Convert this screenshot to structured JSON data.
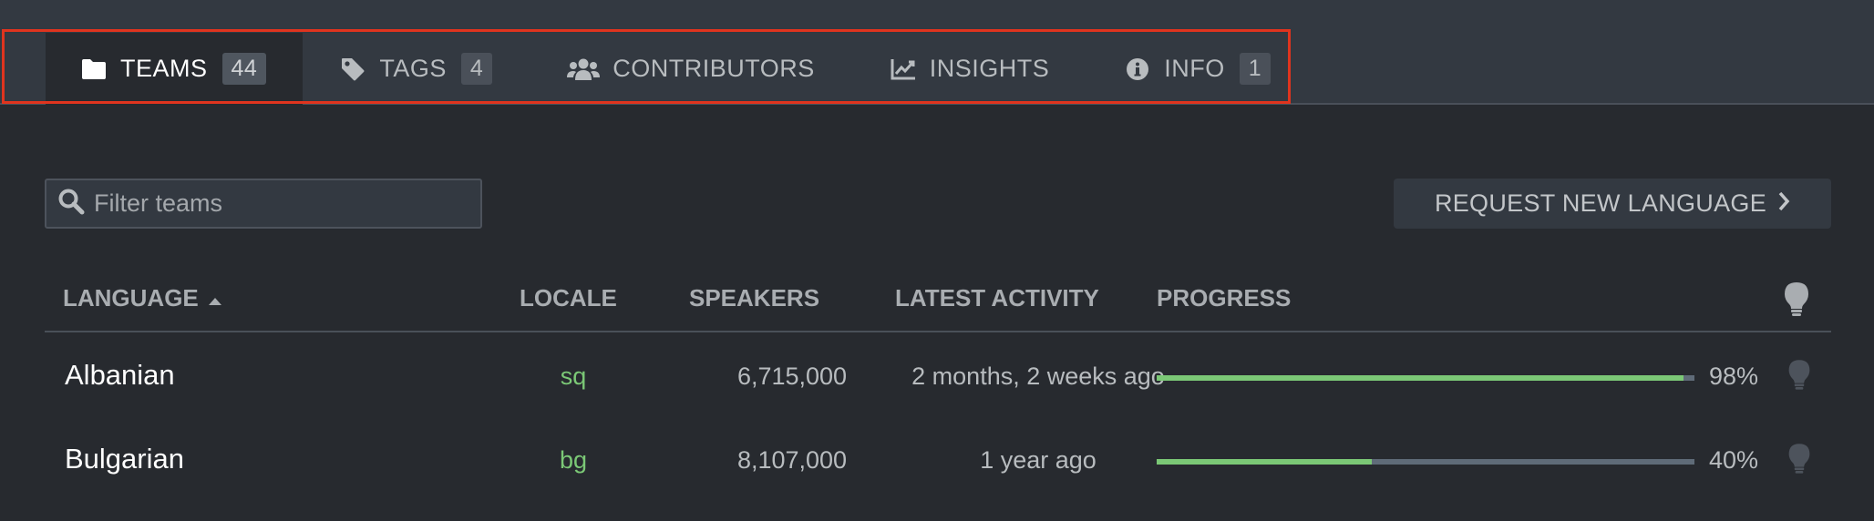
{
  "tabs": [
    {
      "label": "TEAMS",
      "badge": "44",
      "icon": "folder-icon",
      "active": true
    },
    {
      "label": "TAGS",
      "badge": "4",
      "icon": "tag-icon",
      "active": false
    },
    {
      "label": "CONTRIBUTORS",
      "badge": "",
      "icon": "users-icon",
      "active": false
    },
    {
      "label": "INSIGHTS",
      "badge": "",
      "icon": "chart-line-icon",
      "active": false
    },
    {
      "label": "INFO",
      "badge": "1",
      "icon": "info-circle-icon",
      "active": false
    }
  ],
  "filter": {
    "placeholder": "Filter teams",
    "value": ""
  },
  "request_button": {
    "label": "REQUEST NEW LANGUAGE"
  },
  "table": {
    "headers": {
      "language": "LANGUAGE",
      "locale": "LOCALE",
      "speakers": "SPEAKERS",
      "latest_activity": "LATEST ACTIVITY",
      "progress": "PROGRESS"
    },
    "rows": [
      {
        "language": "Albanian",
        "locale": "sq",
        "speakers": "6,715,000",
        "latest_activity": "2 months, 2 weeks ago",
        "progress": 0.98,
        "progress_label": "98%"
      },
      {
        "language": "Bulgarian",
        "locale": "bg",
        "speakers": "8,107,000",
        "latest_activity": "1 year ago",
        "progress": 0.4,
        "progress_label": "40%"
      }
    ]
  },
  "colors": {
    "accent_green": "#7bc876",
    "highlight_red": "#e0341e",
    "background": "#272a2f"
  }
}
